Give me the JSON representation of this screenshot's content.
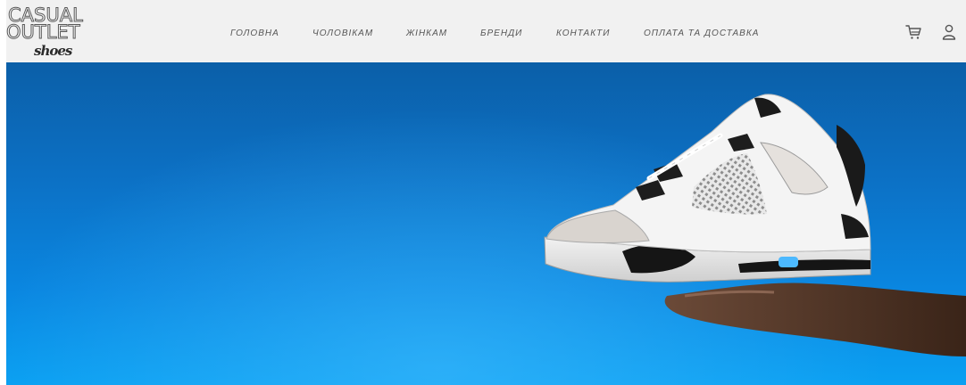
{
  "brand": {
    "line1": "CASUAL",
    "line2": "OUTLET",
    "line3": "shoes"
  },
  "nav": {
    "items": [
      {
        "label": "ГОЛОВНА"
      },
      {
        "label": "ЧОЛОВІКАМ"
      },
      {
        "label": "ЖІНКАМ"
      },
      {
        "label": "БРЕНДИ"
      },
      {
        "label": "КОНТАКТИ"
      },
      {
        "label": "ОПЛАТА ТА ДОСТАВКА"
      }
    ]
  },
  "icons": {
    "cart": "cart-icon",
    "account": "user-icon"
  },
  "colors": {
    "header_bg": "#f1f1f1",
    "hero_blue": "#0c70c4",
    "nav_text": "#555555"
  }
}
